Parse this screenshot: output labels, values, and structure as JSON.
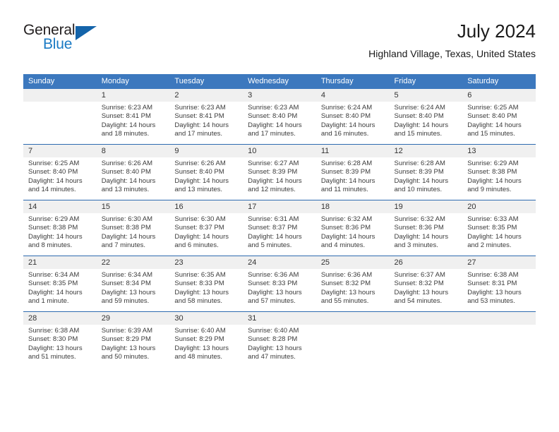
{
  "brand": {
    "name_top": "General",
    "name_bottom": "Blue",
    "accent_color": "#1a7ac4",
    "triangle_color": "#1464aa"
  },
  "header": {
    "title": "July 2024",
    "subtitle": "Highland Village, Texas, United States",
    "header_bg_color": "#3c78be",
    "daynum_bg_color": "#f0f0f0",
    "week_separator_color": "#2e6bb0"
  },
  "weekday_headers": [
    "Sunday",
    "Monday",
    "Tuesday",
    "Wednesday",
    "Thursday",
    "Friday",
    "Saturday"
  ],
  "weeks": [
    [
      {
        "day": "",
        "sunrise": "",
        "sunset": "",
        "daylight": "",
        "empty": true
      },
      {
        "day": "1",
        "sunrise": "Sunrise: 6:23 AM",
        "sunset": "Sunset: 8:41 PM",
        "daylight": "Daylight: 14 hours and 18 minutes."
      },
      {
        "day": "2",
        "sunrise": "Sunrise: 6:23 AM",
        "sunset": "Sunset: 8:41 PM",
        "daylight": "Daylight: 14 hours and 17 minutes."
      },
      {
        "day": "3",
        "sunrise": "Sunrise: 6:23 AM",
        "sunset": "Sunset: 8:40 PM",
        "daylight": "Daylight: 14 hours and 17 minutes."
      },
      {
        "day": "4",
        "sunrise": "Sunrise: 6:24 AM",
        "sunset": "Sunset: 8:40 PM",
        "daylight": "Daylight: 14 hours and 16 minutes."
      },
      {
        "day": "5",
        "sunrise": "Sunrise: 6:24 AM",
        "sunset": "Sunset: 8:40 PM",
        "daylight": "Daylight: 14 hours and 15 minutes."
      },
      {
        "day": "6",
        "sunrise": "Sunrise: 6:25 AM",
        "sunset": "Sunset: 8:40 PM",
        "daylight": "Daylight: 14 hours and 15 minutes."
      }
    ],
    [
      {
        "day": "7",
        "sunrise": "Sunrise: 6:25 AM",
        "sunset": "Sunset: 8:40 PM",
        "daylight": "Daylight: 14 hours and 14 minutes."
      },
      {
        "day": "8",
        "sunrise": "Sunrise: 6:26 AM",
        "sunset": "Sunset: 8:40 PM",
        "daylight": "Daylight: 14 hours and 13 minutes."
      },
      {
        "day": "9",
        "sunrise": "Sunrise: 6:26 AM",
        "sunset": "Sunset: 8:40 PM",
        "daylight": "Daylight: 14 hours and 13 minutes."
      },
      {
        "day": "10",
        "sunrise": "Sunrise: 6:27 AM",
        "sunset": "Sunset: 8:39 PM",
        "daylight": "Daylight: 14 hours and 12 minutes."
      },
      {
        "day": "11",
        "sunrise": "Sunrise: 6:28 AM",
        "sunset": "Sunset: 8:39 PM",
        "daylight": "Daylight: 14 hours and 11 minutes."
      },
      {
        "day": "12",
        "sunrise": "Sunrise: 6:28 AM",
        "sunset": "Sunset: 8:39 PM",
        "daylight": "Daylight: 14 hours and 10 minutes."
      },
      {
        "day": "13",
        "sunrise": "Sunrise: 6:29 AM",
        "sunset": "Sunset: 8:38 PM",
        "daylight": "Daylight: 14 hours and 9 minutes."
      }
    ],
    [
      {
        "day": "14",
        "sunrise": "Sunrise: 6:29 AM",
        "sunset": "Sunset: 8:38 PM",
        "daylight": "Daylight: 14 hours and 8 minutes."
      },
      {
        "day": "15",
        "sunrise": "Sunrise: 6:30 AM",
        "sunset": "Sunset: 8:38 PM",
        "daylight": "Daylight: 14 hours and 7 minutes."
      },
      {
        "day": "16",
        "sunrise": "Sunrise: 6:30 AM",
        "sunset": "Sunset: 8:37 PM",
        "daylight": "Daylight: 14 hours and 6 minutes."
      },
      {
        "day": "17",
        "sunrise": "Sunrise: 6:31 AM",
        "sunset": "Sunset: 8:37 PM",
        "daylight": "Daylight: 14 hours and 5 minutes."
      },
      {
        "day": "18",
        "sunrise": "Sunrise: 6:32 AM",
        "sunset": "Sunset: 8:36 PM",
        "daylight": "Daylight: 14 hours and 4 minutes."
      },
      {
        "day": "19",
        "sunrise": "Sunrise: 6:32 AM",
        "sunset": "Sunset: 8:36 PM",
        "daylight": "Daylight: 14 hours and 3 minutes."
      },
      {
        "day": "20",
        "sunrise": "Sunrise: 6:33 AM",
        "sunset": "Sunset: 8:35 PM",
        "daylight": "Daylight: 14 hours and 2 minutes."
      }
    ],
    [
      {
        "day": "21",
        "sunrise": "Sunrise: 6:34 AM",
        "sunset": "Sunset: 8:35 PM",
        "daylight": "Daylight: 14 hours and 1 minute."
      },
      {
        "day": "22",
        "sunrise": "Sunrise: 6:34 AM",
        "sunset": "Sunset: 8:34 PM",
        "daylight": "Daylight: 13 hours and 59 minutes."
      },
      {
        "day": "23",
        "sunrise": "Sunrise: 6:35 AM",
        "sunset": "Sunset: 8:33 PM",
        "daylight": "Daylight: 13 hours and 58 minutes."
      },
      {
        "day": "24",
        "sunrise": "Sunrise: 6:36 AM",
        "sunset": "Sunset: 8:33 PM",
        "daylight": "Daylight: 13 hours and 57 minutes."
      },
      {
        "day": "25",
        "sunrise": "Sunrise: 6:36 AM",
        "sunset": "Sunset: 8:32 PM",
        "daylight": "Daylight: 13 hours and 55 minutes."
      },
      {
        "day": "26",
        "sunrise": "Sunrise: 6:37 AM",
        "sunset": "Sunset: 8:32 PM",
        "daylight": "Daylight: 13 hours and 54 minutes."
      },
      {
        "day": "27",
        "sunrise": "Sunrise: 6:38 AM",
        "sunset": "Sunset: 8:31 PM",
        "daylight": "Daylight: 13 hours and 53 minutes."
      }
    ],
    [
      {
        "day": "28",
        "sunrise": "Sunrise: 6:38 AM",
        "sunset": "Sunset: 8:30 PM",
        "daylight": "Daylight: 13 hours and 51 minutes."
      },
      {
        "day": "29",
        "sunrise": "Sunrise: 6:39 AM",
        "sunset": "Sunset: 8:29 PM",
        "daylight": "Daylight: 13 hours and 50 minutes."
      },
      {
        "day": "30",
        "sunrise": "Sunrise: 6:40 AM",
        "sunset": "Sunset: 8:29 PM",
        "daylight": "Daylight: 13 hours and 48 minutes."
      },
      {
        "day": "31",
        "sunrise": "Sunrise: 6:40 AM",
        "sunset": "Sunset: 8:28 PM",
        "daylight": "Daylight: 13 hours and 47 minutes."
      },
      {
        "day": "",
        "sunrise": "",
        "sunset": "",
        "daylight": "",
        "empty": true
      },
      {
        "day": "",
        "sunrise": "",
        "sunset": "",
        "daylight": "",
        "empty": true
      },
      {
        "day": "",
        "sunrise": "",
        "sunset": "",
        "daylight": "",
        "empty": true
      }
    ]
  ]
}
